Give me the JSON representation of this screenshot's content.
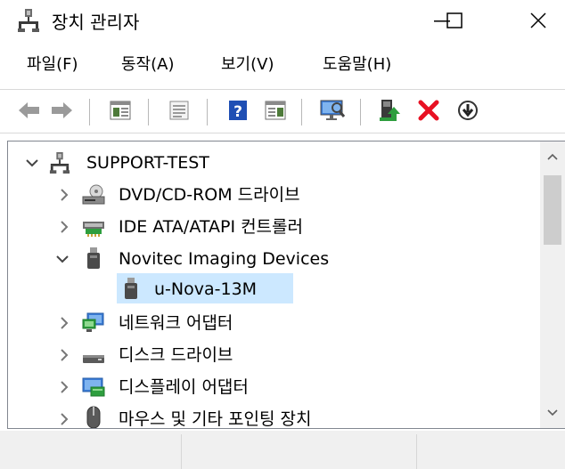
{
  "window": {
    "title": "장치 관리자",
    "controls": {
      "minimize": "—",
      "maximize": "☐",
      "close": "✕"
    }
  },
  "menu": [
    {
      "label": "파일(F)"
    },
    {
      "label": "동작(A)"
    },
    {
      "label": "보기(V)"
    },
    {
      "label": "도움말(H)"
    }
  ],
  "toolbar": {
    "buttons": [
      "back-icon",
      "forward-icon",
      "properties-icon",
      "print-icon",
      "help-icon",
      "view-icon",
      "scan-hardware-icon",
      "update-driver-icon",
      "uninstall-icon",
      "disable-icon"
    ],
    "colors": {
      "uninstall": "#e81123",
      "help": "#1f4fb4",
      "update": "#2e9e3e"
    }
  },
  "tree": {
    "root": {
      "label": "SUPPORT-TEST",
      "icon": "computer-icon",
      "expanded": true
    },
    "items": [
      {
        "label": "DVD/CD-ROM 드라이브",
        "icon": "dvd-drive-icon",
        "expanded": false
      },
      {
        "label": "IDE ATA/ATAPI 컨트롤러",
        "icon": "ide-controller-icon",
        "expanded": false
      },
      {
        "label": "Novitec Imaging Devices",
        "icon": "usb-device-icon",
        "expanded": true,
        "children": [
          {
            "label": "u-Nova-13M",
            "icon": "usb-device-icon",
            "selected": true
          }
        ]
      },
      {
        "label": "네트워크 어댑터",
        "icon": "network-adapter-icon",
        "expanded": false
      },
      {
        "label": "디스크 드라이브",
        "icon": "disk-drive-icon",
        "expanded": false
      },
      {
        "label": "디스플레이 어댑터",
        "icon": "display-adapter-icon",
        "expanded": false
      },
      {
        "label": "마우스 및 기타 포인팅 장치",
        "icon": "mouse-icon",
        "expanded": false
      }
    ],
    "selected_color": "#cce8ff"
  }
}
